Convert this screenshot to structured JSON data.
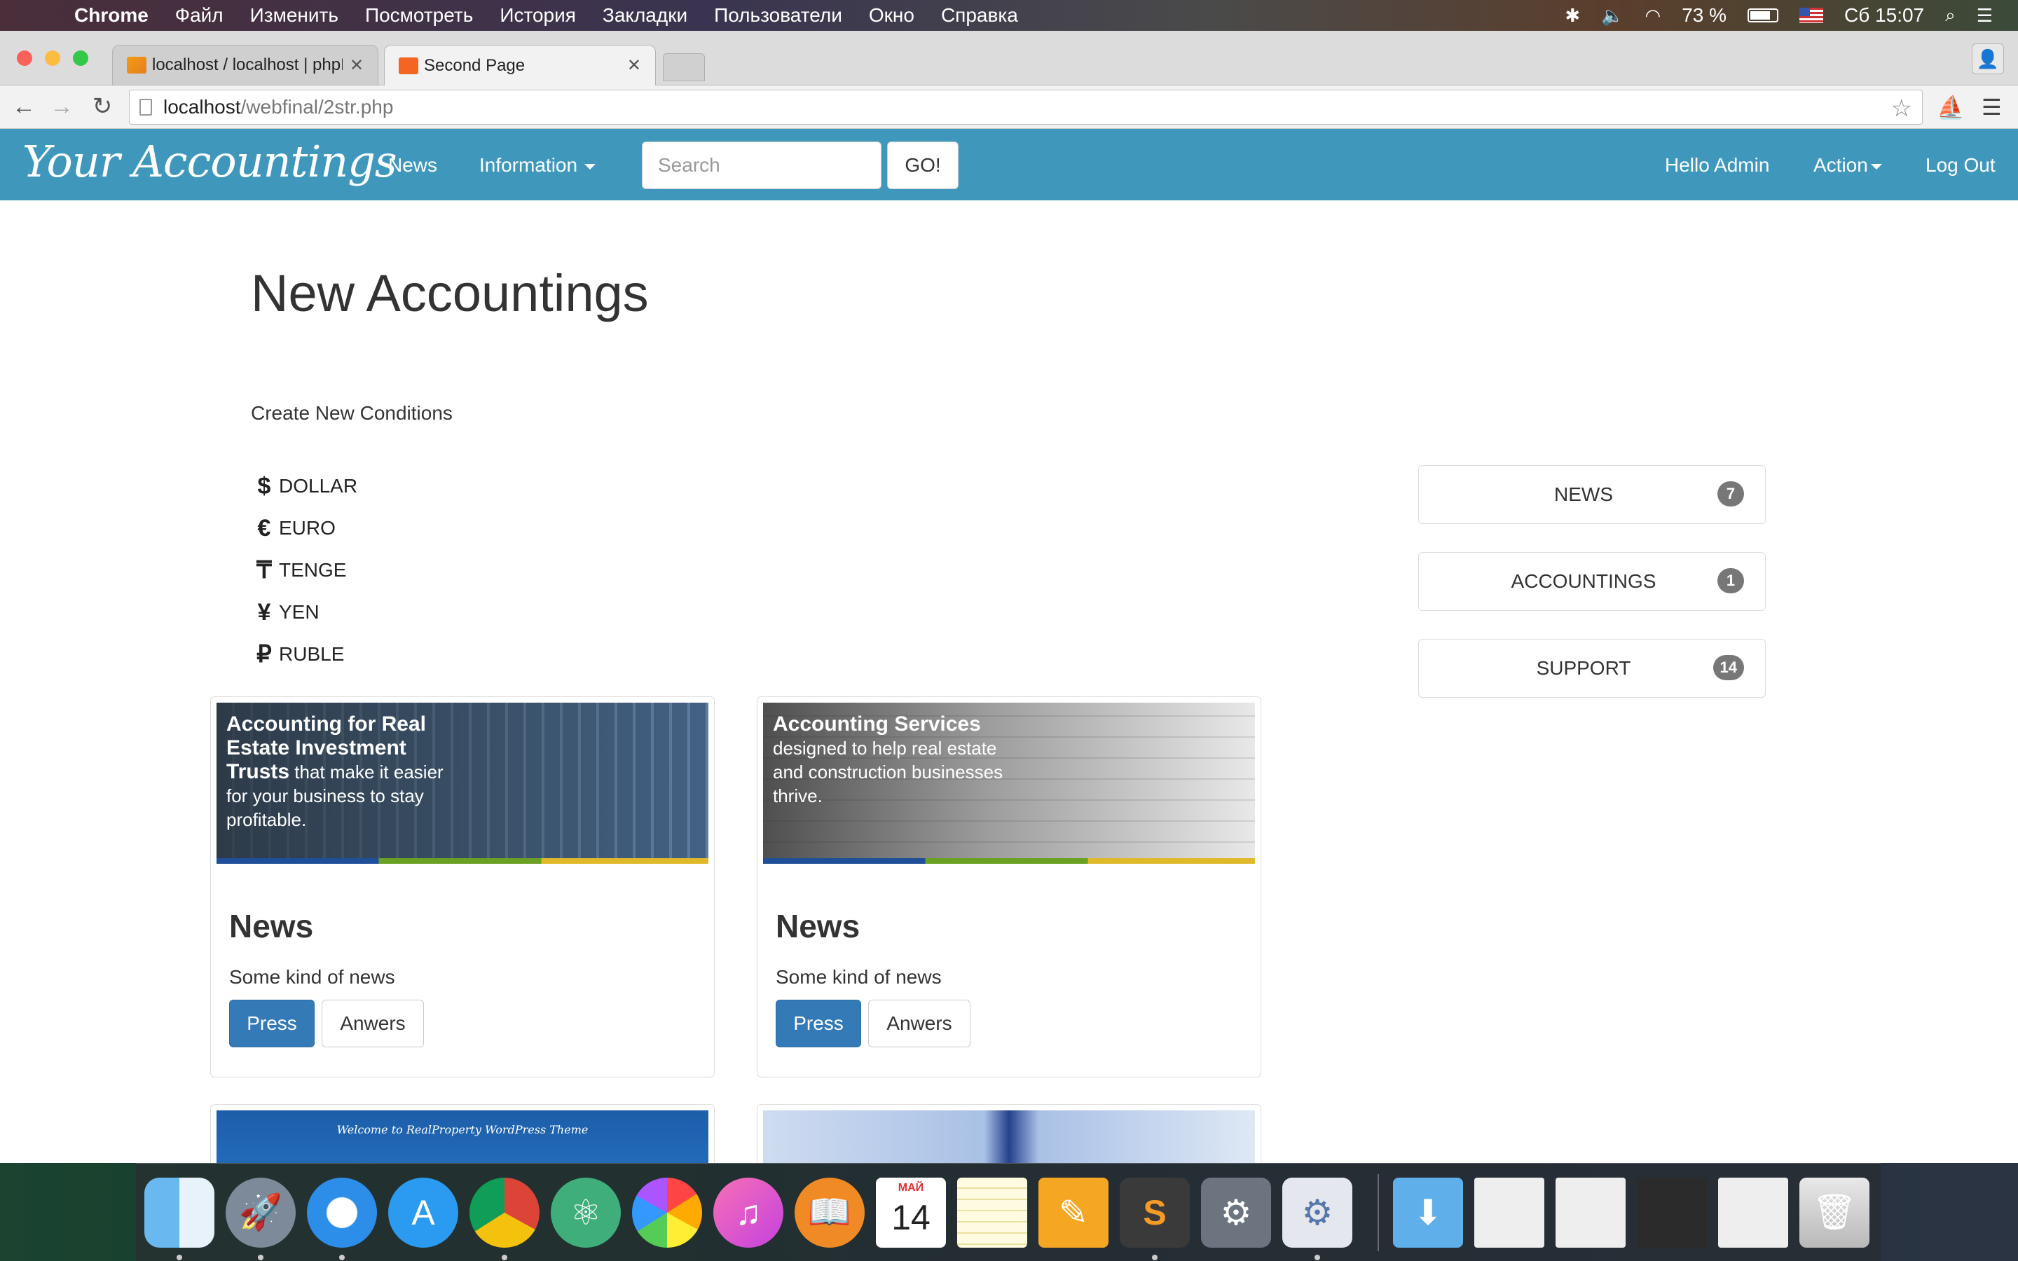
{
  "menubar": {
    "app": "Chrome",
    "items": [
      "Файл",
      "Изменить",
      "Посмотреть",
      "История",
      "Закладки",
      "Пользователи",
      "Окно",
      "Справка"
    ],
    "battery": "73 %",
    "clock": "Сб 15:07"
  },
  "browser": {
    "tabs": [
      {
        "title": "localhost / localhost | phpMyAdmin",
        "active": false
      },
      {
        "title": "Second Page",
        "active": true
      }
    ],
    "url_host": "localhost",
    "url_path": "/webfinal/2str.php"
  },
  "navbar": {
    "brand": "Your Accountings",
    "news": "News",
    "information": "Information",
    "search_placeholder": "Search",
    "go": "GO!",
    "hello": "Hello Admin",
    "action": "Action",
    "logout": "Log Out"
  },
  "page": {
    "title": "New Accountings",
    "subtitle": "Create New Conditions"
  },
  "currencies": [
    {
      "symbol": "$",
      "name": "DOLLAR"
    },
    {
      "symbol": "€",
      "name": "EURO"
    },
    {
      "symbol": "₸",
      "name": "TENGE"
    },
    {
      "symbol": "¥",
      "name": "YEN"
    },
    {
      "symbol": "₽",
      "name": "RUBLE"
    }
  ],
  "side_panel": [
    {
      "label": "NEWS",
      "count": "7"
    },
    {
      "label": "ACCOUNTINGS",
      "count": "1"
    },
    {
      "label": "SUPPORT",
      "count": "14"
    }
  ],
  "cards": [
    {
      "image_heading": "Accounting for Real Estate Investment Trusts",
      "image_text": " that make it easier for your business to stay profitable.",
      "title": "News",
      "text": "Some kind of news",
      "primary": "Press",
      "secondary": "Anwers"
    },
    {
      "image_heading": "Accounting Services",
      "image_text": "designed to help real estate and construction businesses thrive.",
      "title": "News",
      "text": "Some kind of news",
      "primary": "Press",
      "secondary": "Anwers"
    },
    {
      "image_heading": "Welcome to RealProperty WordPress Theme"
    }
  ],
  "dock": {
    "calendar_month": "МАЙ",
    "calendar_day": "14",
    "apps": [
      "finder-icon",
      "launchpad-icon",
      "safari-icon",
      "app-store-icon",
      "chrome-icon",
      "atom-icon",
      "photos-icon",
      "itunes-icon",
      "ibooks-icon",
      "calendar-icon",
      "notes-icon",
      "pages-icon",
      "sublime-text-icon",
      "system-preferences-icon",
      "settings-icon",
      "downloads-folder-icon",
      "trash-icon"
    ]
  },
  "colors": {
    "navbar": "#3f98bb",
    "primary_button": "#337ab7",
    "badge": "#777777"
  }
}
